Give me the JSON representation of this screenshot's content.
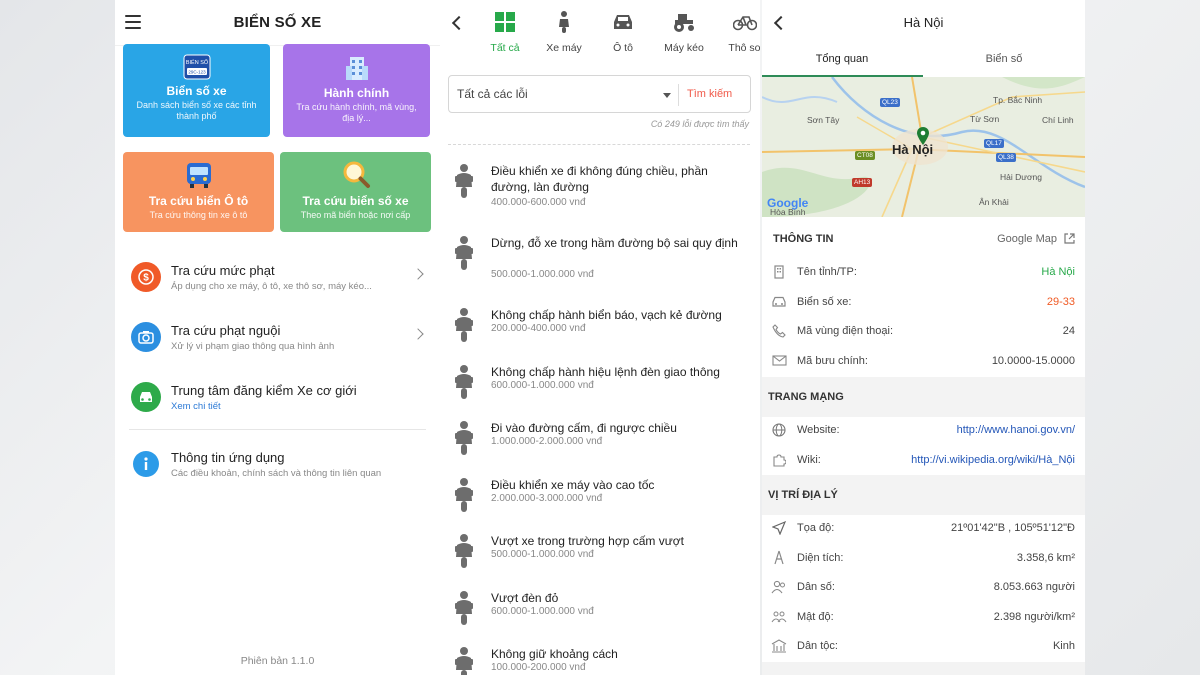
{
  "colors": {
    "tile_blue": "#29a5e6",
    "tile_purple": "#a774e9",
    "tile_orange": "#f79460",
    "tile_green": "#6cc17e",
    "accent_green": "#27a94a",
    "accent_red": "#f05a4a",
    "link_blue": "#2457b8"
  },
  "home": {
    "title": "BIỂN SỐ XE",
    "tiles": [
      {
        "title": "Biển số xe",
        "subtitle": "Danh sách biển số xe các tỉnh thành phố",
        "icon": "license-plate-icon",
        "plate_text": "BIỂN SỐ",
        "plate_num": "29C-123"
      },
      {
        "title": "Hành chính",
        "subtitle": "Tra cứu hành chính, mã vùng, địa lý...",
        "icon": "building-icon"
      },
      {
        "title": "Tra cứu biển Ô tô",
        "subtitle": "Tra cứu thông tin xe ô tô",
        "icon": "bus-icon"
      },
      {
        "title": "Tra cứu biển số xe",
        "subtitle": "Theo mã biển hoặc nơi cấp",
        "icon": "magnifier-icon"
      }
    ],
    "menu": [
      {
        "title": "Tra cứu mức phạt",
        "subtitle": "Áp dụng cho xe máy, ô tô, xe thô sơ, máy kéo...",
        "icon": "money-icon",
        "color": "#f05a28"
      },
      {
        "title": "Tra cứu phạt nguội",
        "subtitle": "Xử lý vi phạm giao thông qua hình ảnh",
        "icon": "camera-icon",
        "color": "#2c8fe0"
      },
      {
        "title": "Trung tâm đăng kiểm Xe cơ giới",
        "subtitle": "Xem chi tiết",
        "icon": "car-icon",
        "color": "#2eaa4a"
      },
      {
        "title": "Thông tin ứng dụng",
        "subtitle": "Các điều khoản, chính sách và thông tin liên quan",
        "icon": "info-icon",
        "color": "#2c9be8"
      }
    ],
    "version": "Phiên bản 1.1.0"
  },
  "fines": {
    "tabs": [
      {
        "label": "Tất cả",
        "icon": "grid-icon"
      },
      {
        "label": "Xe máy",
        "icon": "motorbike-icon"
      },
      {
        "label": "Ô tô",
        "icon": "car-icon"
      },
      {
        "label": "Máy kéo",
        "icon": "tractor-icon"
      },
      {
        "label": "Thô sơ",
        "icon": "bicycle-icon"
      }
    ],
    "filter_selected": "Tất cả các lỗi",
    "search_label": "Tìm kiếm",
    "result_count": "Có 249 lỗi được tìm thấy",
    "violations": [
      {
        "name": "Điều khiển xe đi không đúng chiều, phần đường, làn đường",
        "fine": "400.000-600.000 vnđ"
      },
      {
        "name": "Dừng, đỗ xe trong hầm đường bộ sai quy định",
        "fine": "500.000-1.000.000 vnđ"
      },
      {
        "name": "Không chấp hành biển báo, vạch kẻ đường",
        "fine": "200.000-400.000 vnđ"
      },
      {
        "name": "Không chấp hành hiệu lệnh đèn giao thông",
        "fine": "600.000-1.000.000 vnđ"
      },
      {
        "name": "Đi vào đường cấm, đi ngược chiều",
        "fine": "1.000.000-2.000.000 vnđ"
      },
      {
        "name": "Điều khiển xe máy vào cao tốc",
        "fine": "2.000.000-3.000.000 vnđ"
      },
      {
        "name": "Vượt xe trong trường hợp cấm vượt",
        "fine": "500.000-1.000.000 vnđ"
      },
      {
        "name": "Vượt đèn đỏ",
        "fine": "600.000-1.000.000 vnđ"
      },
      {
        "name": "Không giữ khoảng cách",
        "fine": "100.000-200.000 vnđ"
      }
    ]
  },
  "detail": {
    "title": "Hà Nội",
    "tabs": [
      "Tổng quan",
      "Biển số"
    ],
    "map": {
      "city": "Hà Nội",
      "labels": [
        "Tp. Bắc Ninh",
        "Sơn Tây",
        "Từ Sơn",
        "Chí Linh",
        "Hải Dương",
        "Ân Khải",
        "Hòa Bình"
      ],
      "roads": [
        "QL23",
        "QL17",
        "QL38",
        "CT08",
        "AH13"
      ],
      "brand": "Google"
    },
    "info_section": {
      "title": "THÔNG TIN",
      "map_link": "Google Map"
    },
    "info_rows": [
      {
        "label": "Tên tỉnh/TP:",
        "value": "Hà Nội",
        "icon": "building-icon"
      },
      {
        "label": "Biển số xe:",
        "value": "29-33",
        "icon": "car-icon"
      },
      {
        "label": "Mã vùng điện thoại:",
        "value": "24",
        "icon": "phone-icon"
      },
      {
        "label": "Mã bưu chính:",
        "value": "10.0000-15.0000",
        "icon": "mail-icon"
      }
    ],
    "web_section": {
      "title": "TRANG MẠNG"
    },
    "web_rows": [
      {
        "label": "Website:",
        "value": "http://www.hanoi.gov.vn/",
        "icon": "globe-icon"
      },
      {
        "label": "Wiki:",
        "value": "http://vi.wikipedia.org/wiki/Hà_Nội",
        "icon": "puzzle-icon"
      }
    ],
    "geo_section": {
      "title": "VỊ TRÍ ĐỊA LÝ"
    },
    "geo_rows": [
      {
        "label": "Tọa độ:",
        "value": "21º01'42\"B , 105º51'12\"Đ",
        "icon": "navigation-icon"
      },
      {
        "label": "Diện tích:",
        "value": "3.358,6 km²",
        "icon": "tower-icon"
      },
      {
        "label": "Dân số:",
        "value": "8.053.663 người",
        "icon": "people-icon"
      },
      {
        "label": "Mật độ:",
        "value": "2.398 người/km²",
        "icon": "density-icon"
      },
      {
        "label": "Dân tộc:",
        "value": "Kinh",
        "icon": "temple-icon"
      }
    ]
  }
}
